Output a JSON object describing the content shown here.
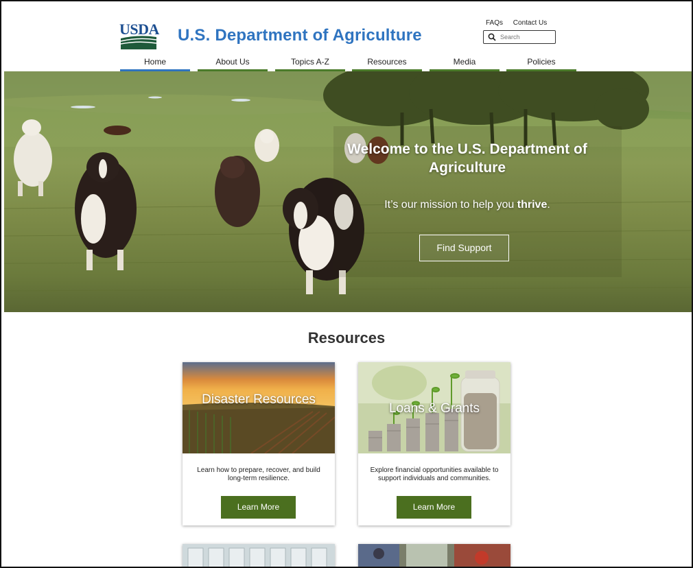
{
  "header": {
    "logo_text": "USDA",
    "site_title": "U.S. Department of Agriculture",
    "util_links": [
      "FAQs",
      "Contact Us"
    ],
    "search_placeholder": "Search"
  },
  "nav": {
    "items": [
      {
        "label": "Home",
        "active": true
      },
      {
        "label": "About Us",
        "active": false
      },
      {
        "label": "Topics A-Z",
        "active": false
      },
      {
        "label": "Resources",
        "active": false
      },
      {
        "label": "Media",
        "active": false
      },
      {
        "label": "Policies",
        "active": false
      }
    ]
  },
  "hero": {
    "title": "Welcome to the U.S. Department of Agriculture",
    "subtitle_pre": "It’s our mission to help you ",
    "subtitle_bold": "thrive",
    "subtitle_post": ".",
    "button_label": "Find Support"
  },
  "resources": {
    "heading": "Resources",
    "cards": [
      {
        "title": "Disaster Resources",
        "description": "Learn how to prepare, recover, and build long-term resilience.",
        "button_label": "Learn More"
      },
      {
        "title": "Loans & Grants",
        "description": "Explore financial opportunities available to support individuals and communities.",
        "button_label": "Learn More"
      }
    ]
  },
  "colors": {
    "brand_blue": "#2f74c0",
    "brand_green": "#4b6f1f",
    "nav_underline": "#4b7b2b"
  }
}
